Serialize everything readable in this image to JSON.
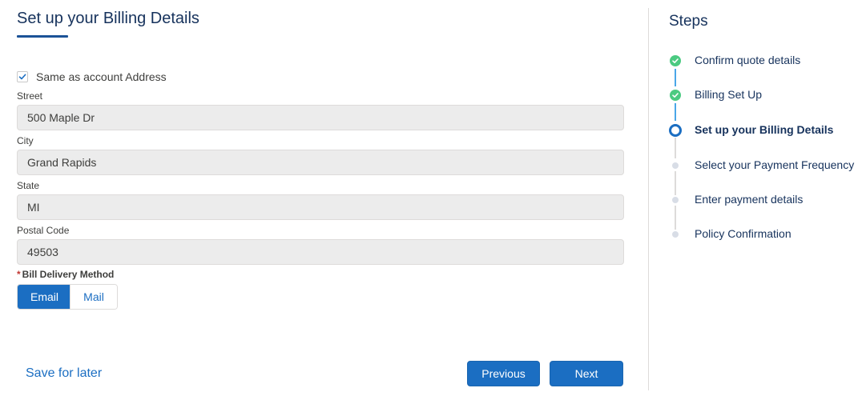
{
  "form": {
    "title": "Set up your Billing Details",
    "same_as_account_label": "Same as account Address",
    "same_as_account_checked": true,
    "fields": [
      {
        "label": "Street",
        "value": "500 Maple Dr"
      },
      {
        "label": "City",
        "value": "Grand Rapids"
      },
      {
        "label": "State",
        "value": "MI"
      },
      {
        "label": "Postal Code",
        "value": "49503"
      }
    ],
    "bill_delivery": {
      "required_mark": "*",
      "label": "Bill Delivery Method",
      "options": [
        "Email",
        "Mail"
      ],
      "selected": "Email"
    }
  },
  "footer": {
    "save_label": "Save for later",
    "previous_label": "Previous",
    "next_label": "Next"
  },
  "steps": {
    "title": "Steps",
    "items": [
      {
        "label": "Confirm quote details",
        "status": "complete"
      },
      {
        "label": "Billing Set Up",
        "status": "complete"
      },
      {
        "label": "Set up your Billing Details",
        "status": "active"
      },
      {
        "label": "Select your Payment Frequency",
        "status": "pending"
      },
      {
        "label": "Enter payment details",
        "status": "pending"
      },
      {
        "label": "Policy Confirmation",
        "status": "pending"
      }
    ]
  },
  "colors": {
    "brand": "#1b6ec2",
    "complete": "#4bca81",
    "title": "#16325c"
  }
}
